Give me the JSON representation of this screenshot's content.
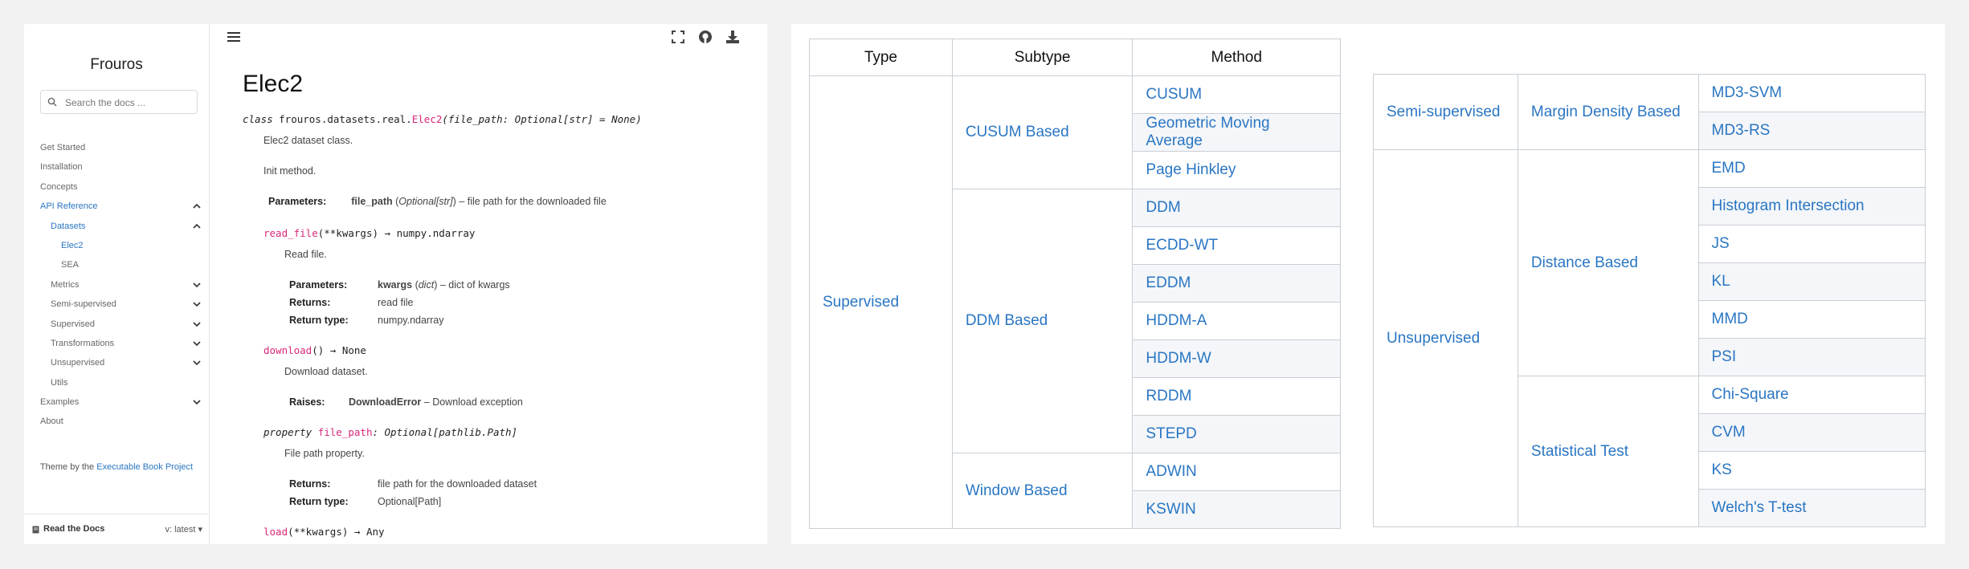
{
  "sidebar": {
    "brand": "Frouros",
    "search_placeholder": "Search the docs ...",
    "nav": [
      {
        "label": "Get Started",
        "indent": 0,
        "active": false,
        "chevron": ""
      },
      {
        "label": "Installation",
        "indent": 0,
        "active": false,
        "chevron": ""
      },
      {
        "label": "Concepts",
        "indent": 0,
        "active": false,
        "chevron": ""
      },
      {
        "label": "API Reference",
        "indent": 0,
        "active": true,
        "chevron": "up"
      },
      {
        "label": "Datasets",
        "indent": 1,
        "active": true,
        "chevron": "up"
      },
      {
        "label": "Elec2",
        "indent": 2,
        "active": true,
        "chevron": ""
      },
      {
        "label": "SEA",
        "indent": 2,
        "active": false,
        "chevron": ""
      },
      {
        "label": "Metrics",
        "indent": 1,
        "active": false,
        "chevron": "down"
      },
      {
        "label": "Semi-supervised",
        "indent": 1,
        "active": false,
        "chevron": "down"
      },
      {
        "label": "Supervised",
        "indent": 1,
        "active": false,
        "chevron": "down"
      },
      {
        "label": "Transformations",
        "indent": 1,
        "active": false,
        "chevron": "down"
      },
      {
        "label": "Unsupervised",
        "indent": 1,
        "active": false,
        "chevron": "down"
      },
      {
        "label": "Utils",
        "indent": 1,
        "active": false,
        "chevron": ""
      },
      {
        "label": "Examples",
        "indent": 0,
        "active": false,
        "chevron": "down"
      },
      {
        "label": "About",
        "indent": 0,
        "active": false,
        "chevron": ""
      }
    ],
    "theme_prefix": "Theme by the ",
    "theme_link": "Executable Book Project",
    "rtd_label": "Read the Docs",
    "rtd_version": "v: latest"
  },
  "doc": {
    "title": "Elec2",
    "class_kw": "class ",
    "class_module": "frouros.datasets.real.",
    "class_name": "Elec2",
    "class_sig": "(file_path: Optional[str] = None)",
    "class_desc": "Elec2 dataset class.",
    "init_desc": "Init method.",
    "params_label": "Parameters:",
    "init_param_name": "file_path",
    "init_param_type": "Optional[str]",
    "init_param_desc": " – file path for the downloaded file",
    "read_file_name": "read_file",
    "read_file_sig": "(**kwargs) → numpy.ndarray",
    "read_file_desc": "Read file.",
    "read_param_name": "kwargs",
    "read_param_type": "dict",
    "read_param_desc": " – dict of kwargs",
    "returns_label": "Returns:",
    "read_returns": "read file",
    "return_type_label": "Return type:",
    "read_return_type": "numpy.ndarray",
    "download_name": "download",
    "download_sig": "() → None",
    "download_desc": "Download dataset.",
    "raises_label": "Raises:",
    "download_raises_name": "DownloadError",
    "download_raises_desc": " – Download exception",
    "prop_kw": "property ",
    "prop_name": "file_path",
    "prop_sig": ": Optional[pathlib.Path]",
    "prop_desc": "File path property.",
    "prop_returns": "file path for the downloaded dataset",
    "prop_return_type": "Optional[Path]",
    "load_name": "load",
    "load_sig": "(**kwargs) → Any"
  },
  "table1": {
    "headers": [
      "Type",
      "Subtype",
      "Method"
    ],
    "type": "Supervised",
    "groups": [
      {
        "subtype": "CUSUM Based",
        "methods": [
          "CUSUM",
          "Geometric Moving Average",
          "Page Hinkley"
        ]
      },
      {
        "subtype": "DDM Based",
        "methods": [
          "DDM",
          "ECDD-WT",
          "EDDM",
          "HDDM-A",
          "HDDM-W",
          "RDDM",
          "STEPD"
        ]
      },
      {
        "subtype": "Window Based",
        "methods": [
          "ADWIN",
          "KSWIN"
        ]
      }
    ]
  },
  "table2": {
    "rows": [
      {
        "type": "Semi-supervised",
        "groups": [
          {
            "subtype": "Margin Density Based",
            "methods": [
              "MD3-SVM",
              "MD3-RS"
            ]
          }
        ]
      },
      {
        "type": "Unsupervised",
        "groups": [
          {
            "subtype": "Distance Based",
            "methods": [
              "EMD",
              "Histogram Intersection",
              "JS",
              "KL",
              "MMD",
              "PSI"
            ]
          },
          {
            "subtype": "Statistical Test",
            "methods": [
              "Chi-Square",
              "CVM",
              "KS",
              "Welch's T-test"
            ]
          }
        ]
      }
    ]
  },
  "colors": {
    "accent": "#2a76c3",
    "code_pink": "#d9287a",
    "alt_row": "#f4f6f9"
  },
  "icons": [
    "hamburger-menu-icon",
    "fullscreen-icon",
    "github-icon",
    "download-icon",
    "search-icon",
    "book-icon"
  ]
}
